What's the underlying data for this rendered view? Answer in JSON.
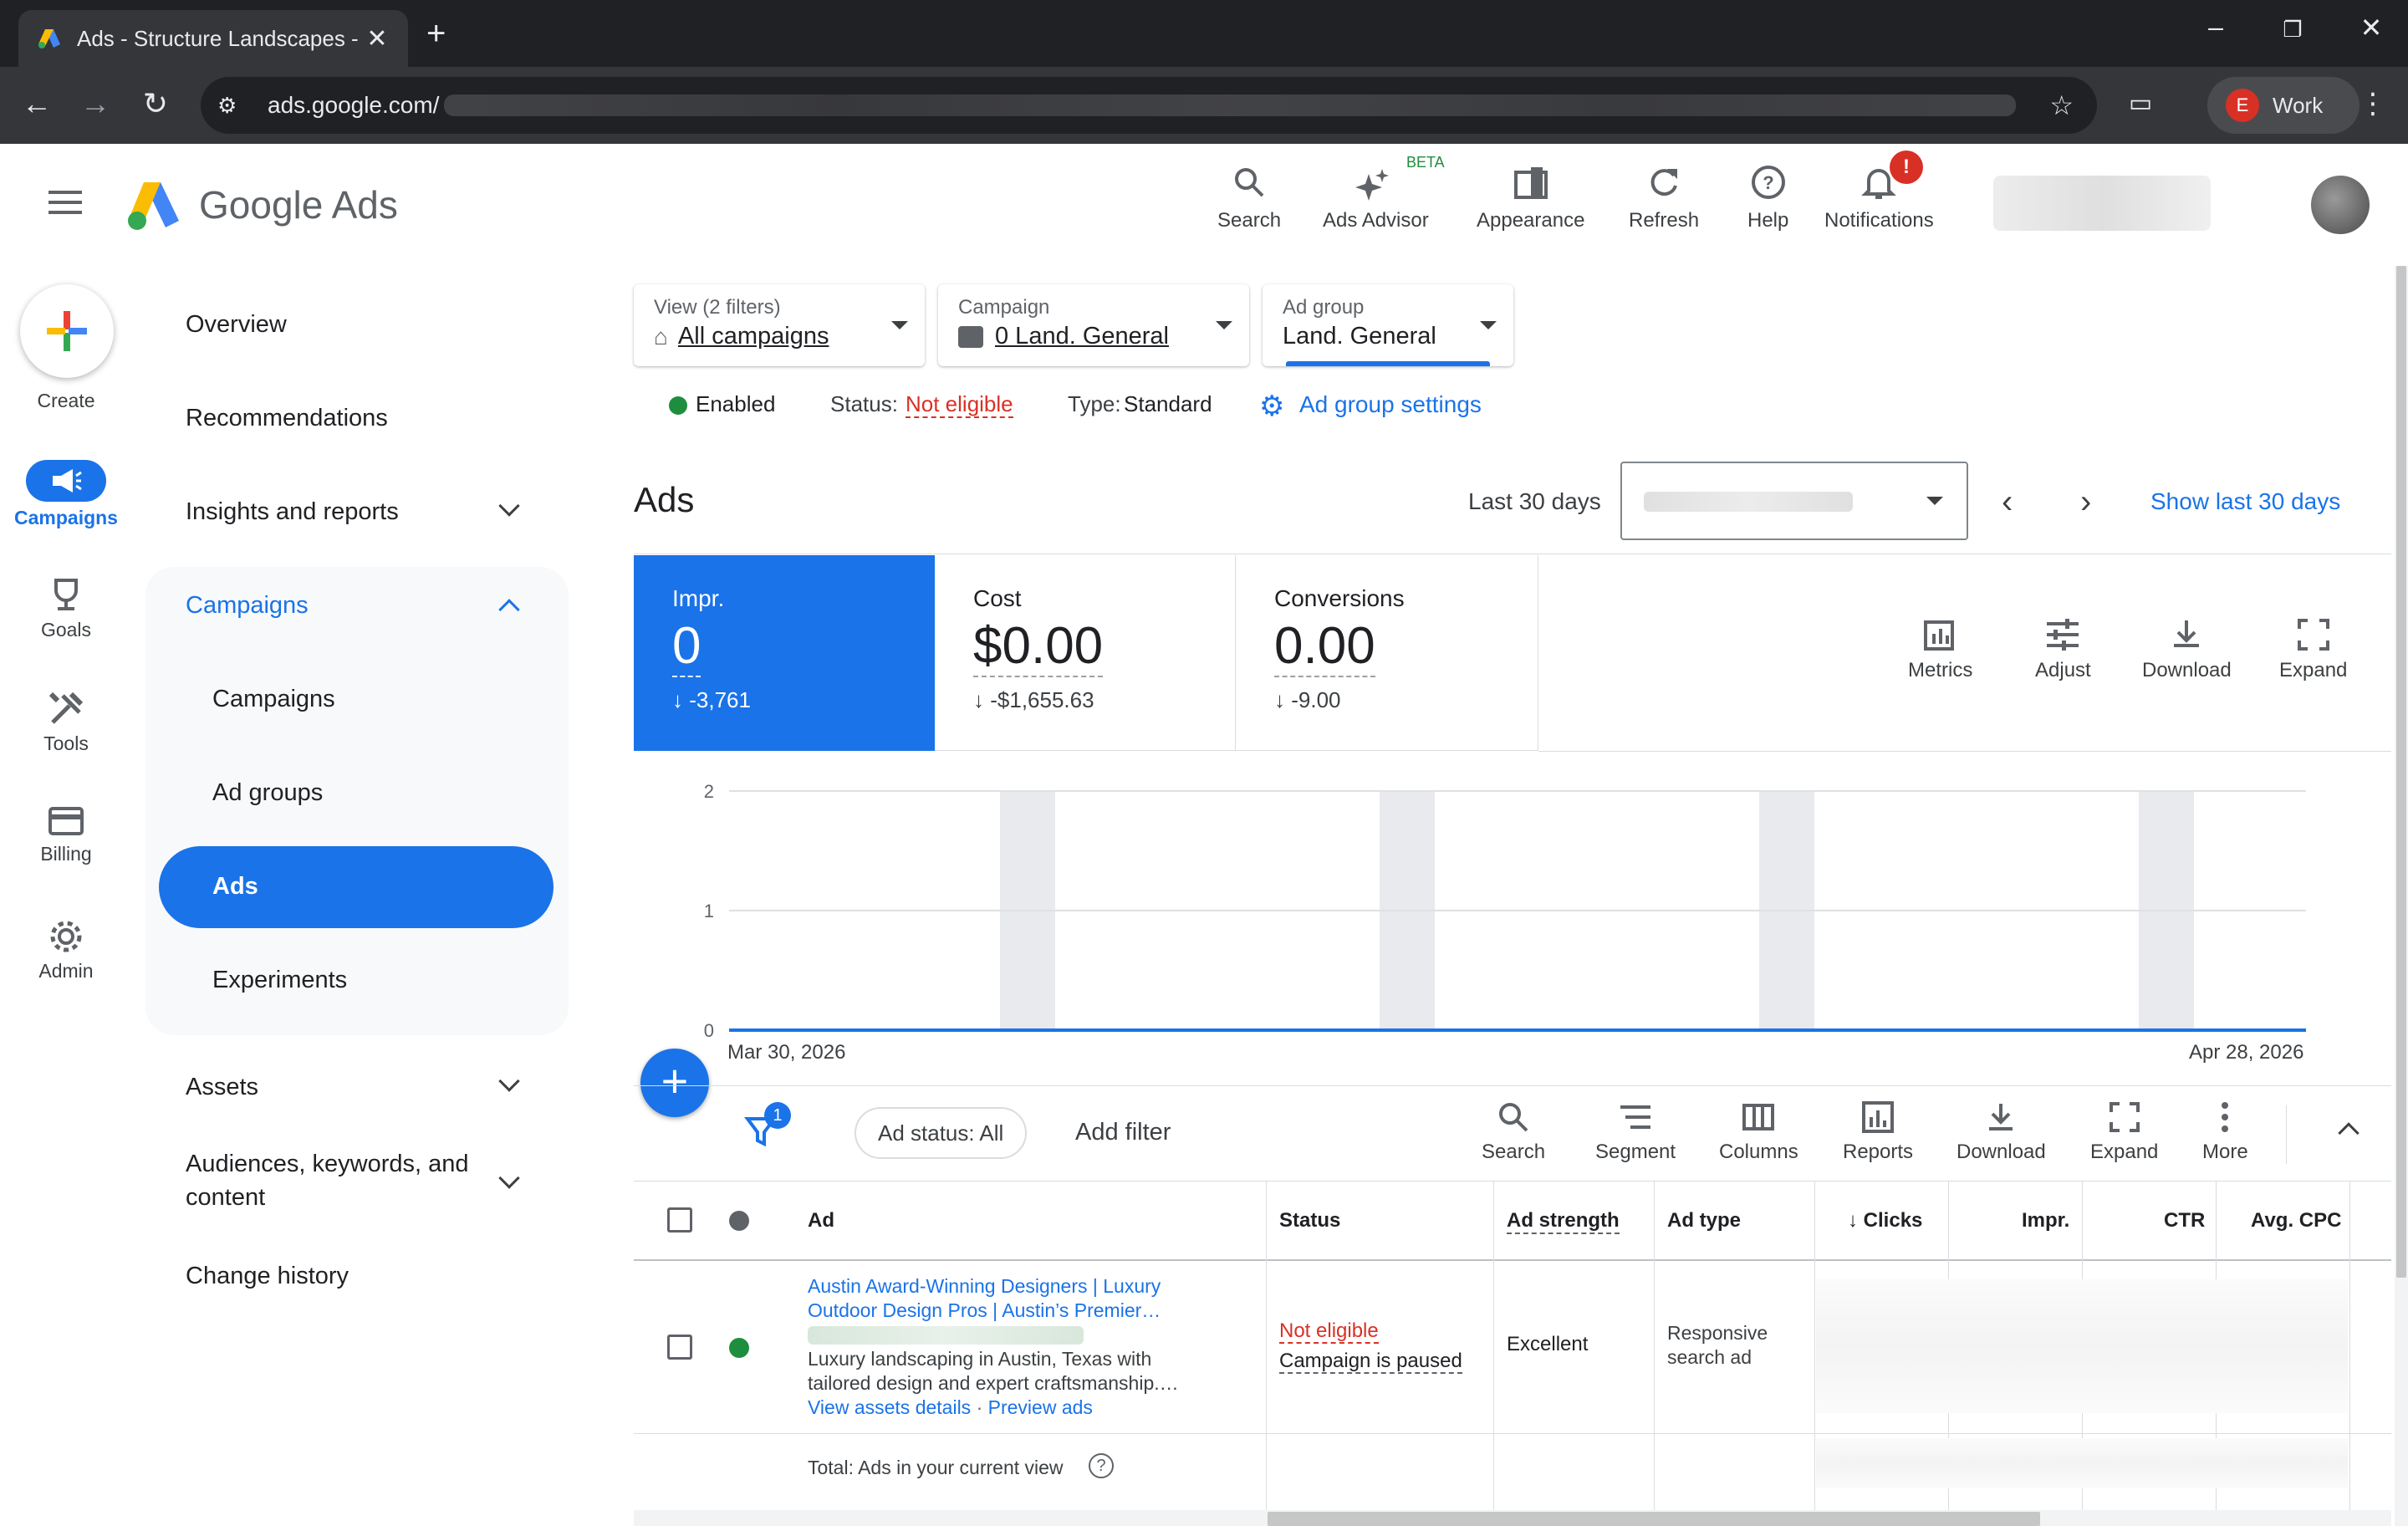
{
  "browser": {
    "tab_title": "Ads - Structure Landscapes - Go",
    "url": "ads.google.com/",
    "profile_initial": "E",
    "profile_label": "Work"
  },
  "header": {
    "brand": "Google Ads",
    "buttons": [
      {
        "label": "Search",
        "icon": "search-icon"
      },
      {
        "label": "Ads Advisor",
        "icon": "sparkle-icon",
        "badge": "BETA"
      },
      {
        "label": "Appearance",
        "icon": "appearance-icon"
      },
      {
        "label": "Refresh",
        "icon": "refresh-icon"
      },
      {
        "label": "Help",
        "icon": "help-icon"
      },
      {
        "label": "Notifications",
        "icon": "bell-icon",
        "badge": "!"
      }
    ]
  },
  "rail": {
    "create": "Create",
    "items": [
      "Campaigns",
      "Goals",
      "Tools",
      "Billing",
      "Admin"
    ]
  },
  "nav": {
    "overview": "Overview",
    "recommendations": "Recommendations",
    "insights": "Insights and reports",
    "campaigns_section": "Campaigns",
    "campaigns": "Campaigns",
    "ad_groups": "Ad groups",
    "ads": "Ads",
    "experiments": "Experiments",
    "assets": "Assets",
    "audiences_line1": "Audiences, keywords, and",
    "audiences_line2": "content",
    "change_history": "Change history"
  },
  "selectors": {
    "view_label": "View (2 filters)",
    "view_value": "All campaigns",
    "campaign_label": "Campaign",
    "campaign_value": "0 Land. General",
    "adgroup_label": "Ad group",
    "adgroup_value": "Land. General"
  },
  "status": {
    "enabled": "Enabled",
    "status_label": "Status:",
    "status_value": "Not eligible",
    "type_label": "Type:",
    "type_value": "Standard",
    "settings_link": "Ad group settings"
  },
  "page": {
    "title": "Ads",
    "date_range_label": "Last 30 days",
    "show_last": "Show last 30 days"
  },
  "scorecards": [
    {
      "title": "Impr.",
      "value": "0",
      "delta": "-3,761"
    },
    {
      "title": "Cost",
      "value": "$0.00",
      "delta": "-$1,655.63"
    },
    {
      "title": "Conversions",
      "value": "0.00",
      "delta": "-9.00"
    }
  ],
  "chart_tools": [
    "Metrics",
    "Adjust",
    "Download",
    "Expand"
  ],
  "chart_data": {
    "type": "line",
    "x_start": "Mar 30, 2026",
    "x_end": "Apr 28, 2026",
    "y_ticks": [
      "2",
      "1",
      "0"
    ],
    "ylim": [
      0,
      2
    ],
    "series": [
      {
        "values": [
          0,
          0,
          0,
          0,
          0,
          0,
          0,
          0,
          0,
          0,
          0,
          0,
          0,
          0,
          0,
          0,
          0,
          0,
          0,
          0,
          0,
          0,
          0,
          0,
          0,
          0,
          0,
          0,
          0,
          0
        ]
      }
    ],
    "shaded_bands": 4,
    "line_color": "#1a73e8"
  },
  "table_toolbar": {
    "filter_count": "1",
    "ad_status_chip": "Ad status: All",
    "add_filter": "Add filter",
    "tools": [
      "Search",
      "Segment",
      "Columns",
      "Reports",
      "Download",
      "Expand",
      "More"
    ]
  },
  "table": {
    "headers": {
      "ad": "Ad",
      "status": "Status",
      "ad_strength": "Ad strength",
      "ad_type": "Ad type",
      "clicks": "Clicks",
      "impr": "Impr.",
      "ctr": "CTR",
      "avg_cpc": "Avg. CPC"
    },
    "row": {
      "headline1": "Austin Award-Winning Designers | Luxury",
      "headline2": "Outdoor Design Pros | Austin’s Premier…",
      "desc1": "Luxury landscaping in Austin, Texas with",
      "desc2": "tailored design and expert craftsmanship.…",
      "view_assets": "View assets details",
      "preview": "Preview ads",
      "status1": "Not eligible",
      "status2": "Campaign is paused",
      "ad_strength": "Excellent",
      "ad_type1": "Responsive",
      "ad_type2": "search ad"
    },
    "total_label": "Total: Ads in your current view"
  },
  "colors": {
    "accent": "#1a73e8",
    "enabled_green": "#1e8e3e",
    "error_red": "#d93025"
  }
}
